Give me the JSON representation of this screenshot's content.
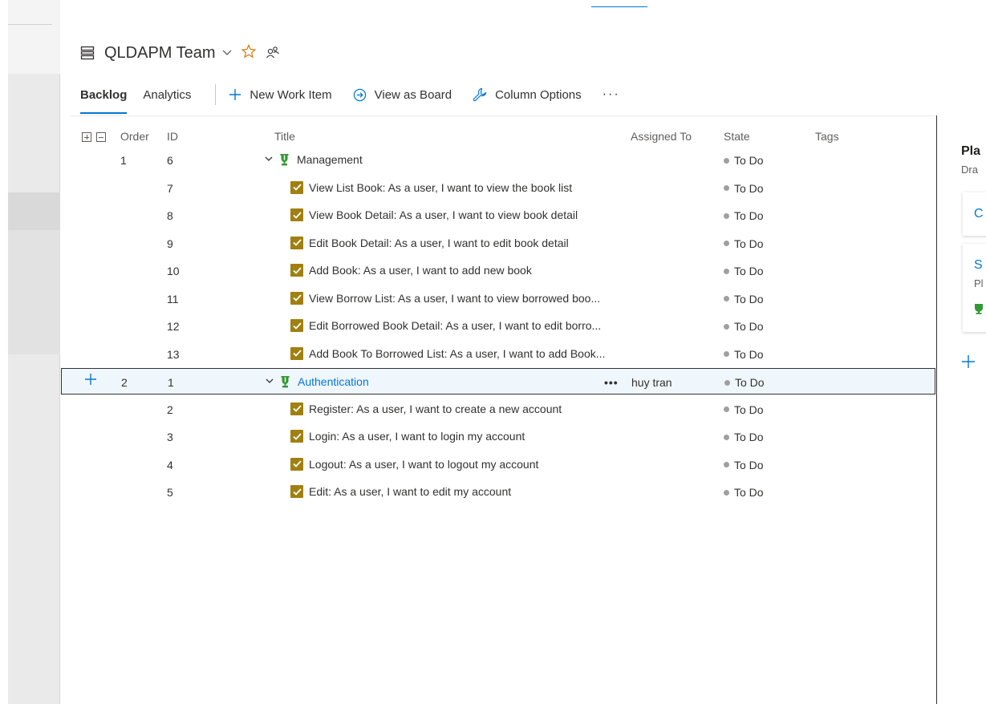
{
  "header": {
    "team_name": "QLDAPM Team"
  },
  "toolbar": {
    "tabs": [
      {
        "label": "Backlog",
        "active": true
      },
      {
        "label": "Analytics",
        "active": false
      }
    ],
    "new_work_item": "New Work Item",
    "view_as_board": "View as Board",
    "column_options": "Column Options",
    "more": "···"
  },
  "grid": {
    "columns": {
      "order": "Order",
      "id": "ID",
      "title": "Title",
      "assigned_to": "Assigned To",
      "state": "State",
      "tags": "Tags"
    },
    "rows": [
      {
        "order": "1",
        "id": "6",
        "title": "Management",
        "type": "epic",
        "assigned": "",
        "state": "To Do"
      },
      {
        "order": "",
        "id": "7",
        "title": "View List Book: As a user, I want to view the book list",
        "type": "task",
        "assigned": "",
        "state": "To Do"
      },
      {
        "order": "",
        "id": "8",
        "title": "View Book Detail: As a user, I want to view book detail",
        "type": "task",
        "assigned": "",
        "state": "To Do"
      },
      {
        "order": "",
        "id": "9",
        "title": "Edit Book Detail: As a user, I want to edit book detail",
        "type": "task",
        "assigned": "",
        "state": "To Do"
      },
      {
        "order": "",
        "id": "10",
        "title": "Add Book: As a user, I want to add new book",
        "type": "task",
        "assigned": "",
        "state": "To Do"
      },
      {
        "order": "",
        "id": "11",
        "title": "View Borrow List: As a user, I want to view borrowed boo...",
        "type": "task",
        "assigned": "",
        "state": "To Do"
      },
      {
        "order": "",
        "id": "12",
        "title": "Edit Borrowed Book Detail: As a user, I want to edit borro...",
        "type": "task",
        "assigned": "",
        "state": "To Do"
      },
      {
        "order": "",
        "id": "13",
        "title": "Add Book To Borrowed List: As a user, I want to add Book...",
        "type": "task",
        "assigned": "",
        "state": "To Do"
      },
      {
        "order": "2",
        "id": "1",
        "title": "Authentication",
        "type": "epic",
        "assigned": "huy tran",
        "state": "To Do",
        "selected": true
      },
      {
        "order": "",
        "id": "2",
        "title": "Register: As a user, I want to create a new account",
        "type": "task",
        "assigned": "",
        "state": "To Do"
      },
      {
        "order": "",
        "id": "3",
        "title": "Login: As a user, I want to login my account",
        "type": "task",
        "assigned": "",
        "state": "To Do"
      },
      {
        "order": "",
        "id": "4",
        "title": "Logout: As a user, I want to logout my account",
        "type": "task",
        "assigned": "",
        "state": "To Do"
      },
      {
        "order": "",
        "id": "5",
        "title": "Edit: As a user, I want to edit my account",
        "type": "task",
        "assigned": "",
        "state": "To Do"
      }
    ],
    "row_more": "•••"
  },
  "planning_panel": {
    "title": "Pla",
    "subtitle": "Dra",
    "card1_text": "C",
    "card2_title": "S",
    "card2_sub": "Pl"
  },
  "colors": {
    "accent": "#0078d4",
    "task_check": "#a08010",
    "epic_green": "#339933",
    "star": "#d47500"
  }
}
